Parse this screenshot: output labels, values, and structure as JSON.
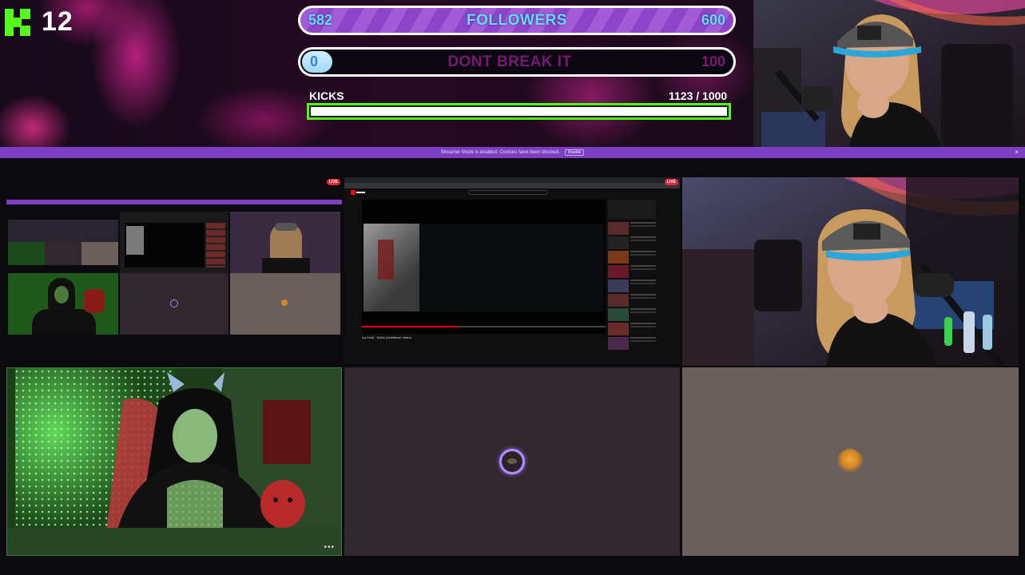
{
  "brand": {
    "viewer_count": "12",
    "icon": "kick-logo-icon",
    "accent": "#53fc18"
  },
  "followers_goal": {
    "current": "582",
    "title": "FOLLOWERS",
    "target": "600",
    "progress_fraction": 0.97
  },
  "dont_break_goal": {
    "current": "0",
    "title": "DONT BREAK IT",
    "target": "100",
    "progress_fraction": 0.0
  },
  "kicks_goal": {
    "label": "KICKS",
    "count": "1123  / 1000",
    "progress_fraction": 1.0
  },
  "notice": {
    "text": "Streamer Mode is enabled. Cookies have been blocked.",
    "button_label": "Disable",
    "close_label": "×"
  },
  "tiles": {
    "live_label": "LIVE",
    "more_label": "•••",
    "youtube_video_title": "Ivy Kenji - NoNo (Unfolklore Video)"
  },
  "colors": {
    "notice_bar": "#7d3fc2",
    "followers_bar": "#8e44c9",
    "followers_text": "#6fd6ff",
    "dont_break_text": "#7a1877",
    "live_badge": "#e0283b"
  }
}
